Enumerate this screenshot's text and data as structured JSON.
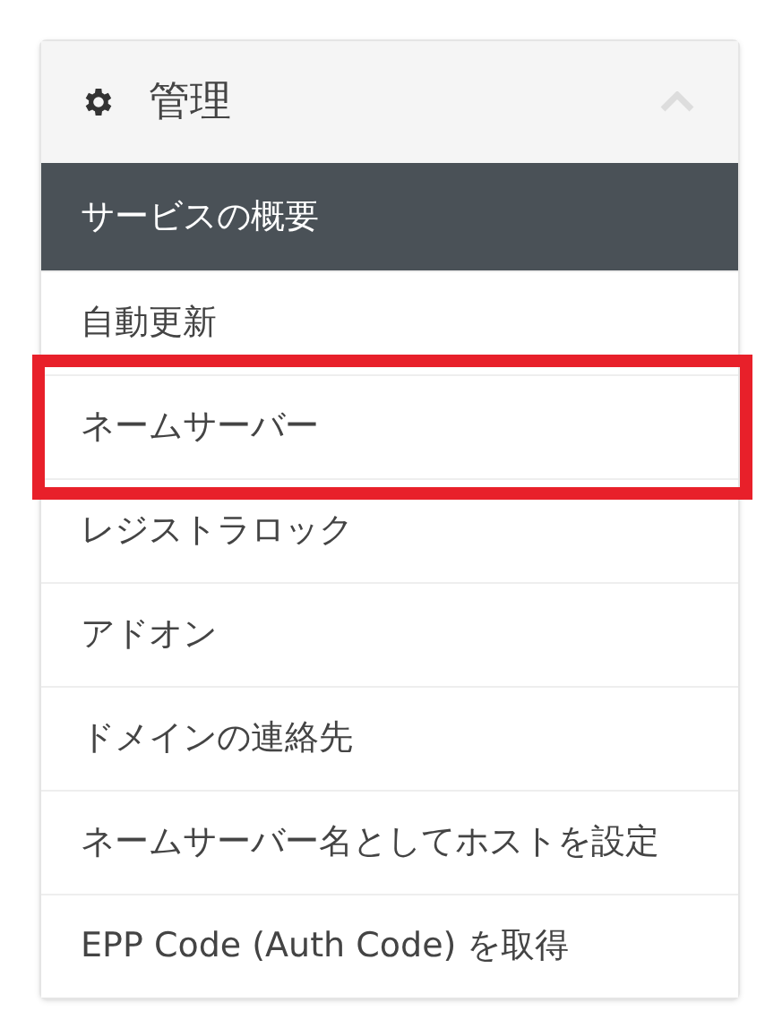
{
  "panel": {
    "title": "管理",
    "expanded": true
  },
  "items": [
    {
      "label": "サービスの概要",
      "selected": true,
      "highlighted": false
    },
    {
      "label": "自動更新",
      "selected": false,
      "highlighted": false
    },
    {
      "label": "ネームサーバー",
      "selected": false,
      "highlighted": true
    },
    {
      "label": "レジストラロック",
      "selected": false,
      "highlighted": false
    },
    {
      "label": "アドオン",
      "selected": false,
      "highlighted": false
    },
    {
      "label": "ドメインの連絡先",
      "selected": false,
      "highlighted": false
    },
    {
      "label": "ネームサーバー名としてホストを設定",
      "selected": false,
      "highlighted": false
    },
    {
      "label": "EPP Code (Auth Code) を取得",
      "selected": false,
      "highlighted": false
    }
  ]
}
